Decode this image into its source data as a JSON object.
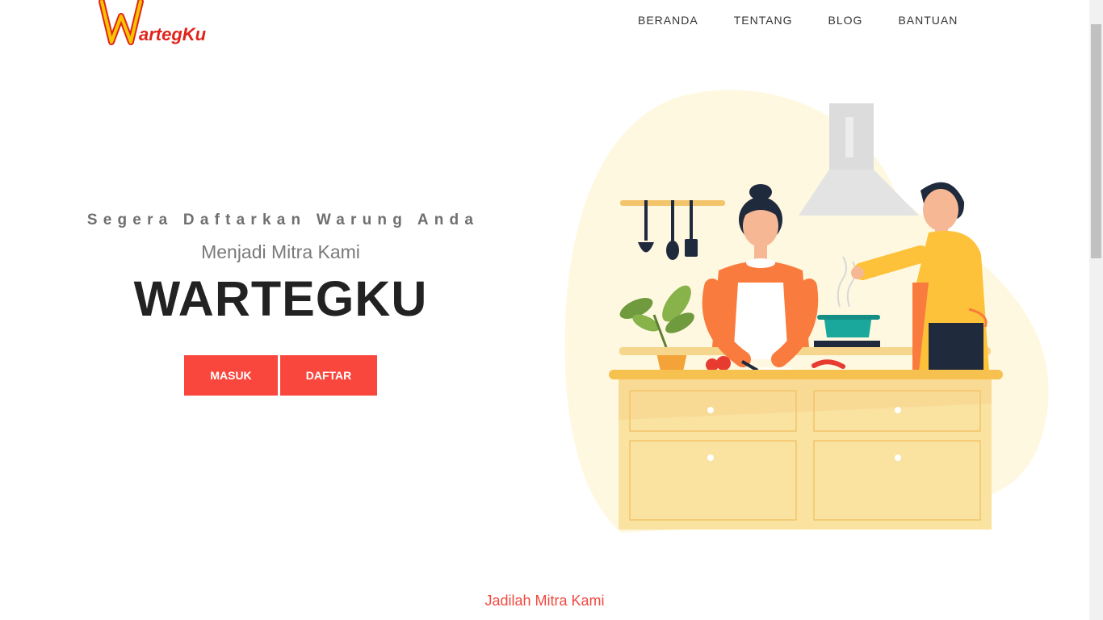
{
  "brand": {
    "logo_text": "WartegKu",
    "colors": {
      "yellow": "#f7c500",
      "red": "#e0241b",
      "accent": "#f9473e"
    }
  },
  "nav": {
    "items": [
      {
        "label": "BERANDA"
      },
      {
        "label": "TENTANG"
      },
      {
        "label": "BLOG"
      },
      {
        "label": "BANTUAN"
      }
    ]
  },
  "hero": {
    "tagline": "Segera Daftarkan Warung Anda",
    "subtitle": "Menjadi Mitra Kami",
    "title": "WARTEGKU",
    "buttons": {
      "login_label": "MASUK",
      "register_label": "DAFTAR"
    }
  },
  "section": {
    "label": "Jadilah Mitra Kami"
  },
  "illustration": {
    "icon": "kitchen-cooking-couple-illustration"
  }
}
